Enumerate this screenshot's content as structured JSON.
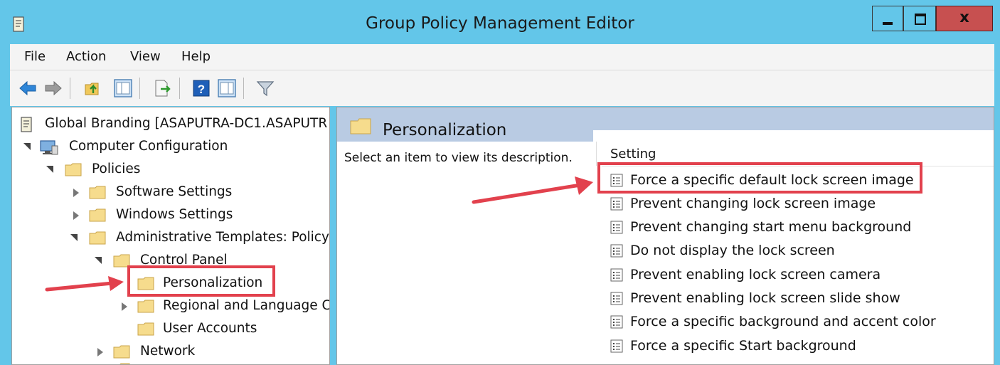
{
  "window": {
    "title": "Group Policy Management Editor",
    "close_glyph": "x"
  },
  "menu": [
    "File",
    "Action",
    "View",
    "Help"
  ],
  "toolbar": {
    "buttons": [
      "back-icon",
      "forward-icon",
      "up-folder-icon",
      "show-hide-tree-icon",
      "export-list-icon",
      "help-icon",
      "show-hide-action-pane-icon",
      "filter-icon"
    ]
  },
  "tree": {
    "root": "Global Branding [ASAPUTRA-DC1.ASAPUTR",
    "computer_configuration": "Computer Configuration",
    "policies": "Policies",
    "software_settings": "Software Settings",
    "windows_settings": "Windows Settings",
    "administrative_templates": "Administrative Templates: Policy",
    "control_panel": "Control Panel",
    "personalization": "Personalization",
    "regional": "Regional and Language C",
    "user_accounts": "User Accounts",
    "network": "Network"
  },
  "details": {
    "title": "Personalization",
    "description": "Select an item to view its description.",
    "column_header": "Setting",
    "settings": [
      "Force a specific default lock screen image",
      "Prevent changing lock screen image",
      "Prevent changing start menu background",
      "Do not display the lock screen",
      "Prevent enabling lock screen camera",
      "Prevent enabling lock screen slide show",
      "Force a specific background and accent color",
      "Force a specific Start background"
    ]
  },
  "colors": {
    "titlebar": "#63c6e9",
    "close_button": "#c75050",
    "header_band": "#b9cbe3",
    "annotation_red": "#e2414d"
  }
}
